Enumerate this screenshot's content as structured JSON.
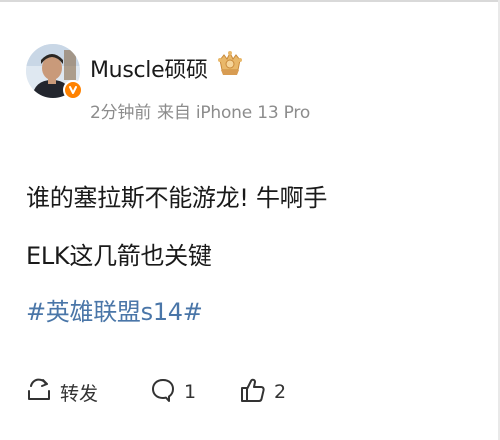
{
  "post": {
    "author": {
      "name": "Muscle硕硕",
      "icons": [
        "avatar",
        "verified-badge-icon",
        "vip-crown-badge-icon"
      ]
    },
    "meta": {
      "time": "2分钟前",
      "source": "来自 iPhone 13 Pro"
    },
    "lines": [
      "谁的塞拉斯不能游龙! 牛啊手",
      "ELK这几箭也关键"
    ],
    "hashtag": "#英雄联盟s14#"
  },
  "actions": {
    "repost": {
      "icon": "repost-icon",
      "label": "转发"
    },
    "comment": {
      "icon": "comment-icon",
      "count": "1"
    },
    "like": {
      "icon": "thumbs-up-icon",
      "count": "2"
    }
  },
  "colors": {
    "hashtag": "#4a76a8",
    "verified": "#ff8200",
    "meta_text": "#8c8c8c"
  }
}
